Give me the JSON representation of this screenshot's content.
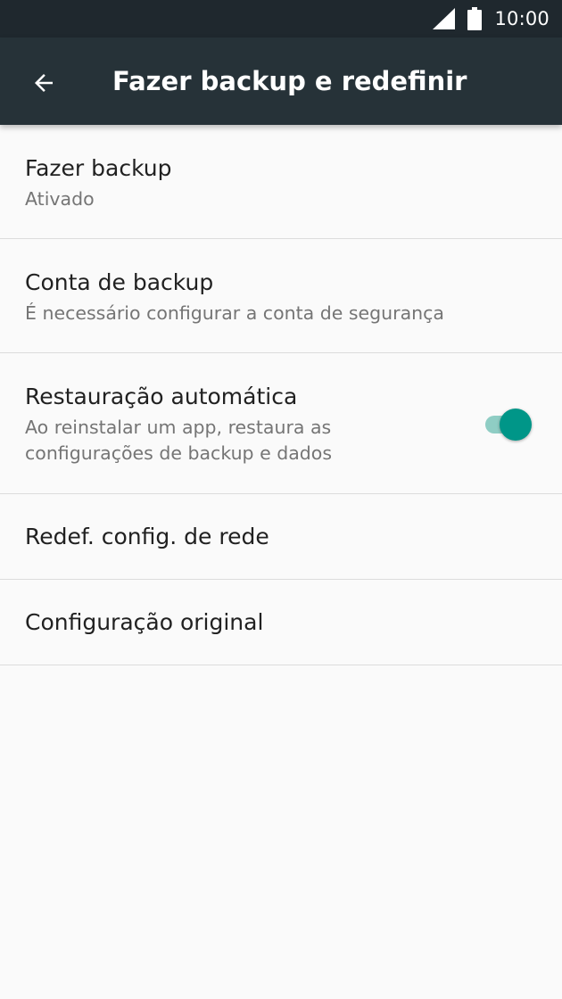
{
  "status_bar": {
    "time": "10:00",
    "icons": [
      "cellular-signal-icon",
      "battery-icon"
    ]
  },
  "app_bar": {
    "back_icon": "arrow-back-icon",
    "title": "Fazer backup e redefinir"
  },
  "settings": {
    "backup": {
      "title": "Fazer backup",
      "summary": "Ativado"
    },
    "backup_account": {
      "title": "Conta de backup",
      "summary": "É necessário configurar a conta de segurança"
    },
    "auto_restore": {
      "title": "Restauração automática",
      "summary": "Ao reinstalar um app, restaura as configurações de backup e dados",
      "enabled": true
    },
    "network_reset": {
      "title": "Redef. config. de rede"
    },
    "factory_reset": {
      "title": "Configuração original"
    }
  },
  "colors": {
    "status_bar": "#1f282e",
    "app_bar": "#263238",
    "background": "#fafafa",
    "accent": "#009688",
    "accent_track": "#8fcdc4",
    "primary_text": "#212121",
    "secondary_text": "#757575",
    "divider": "#dcdcdc"
  }
}
